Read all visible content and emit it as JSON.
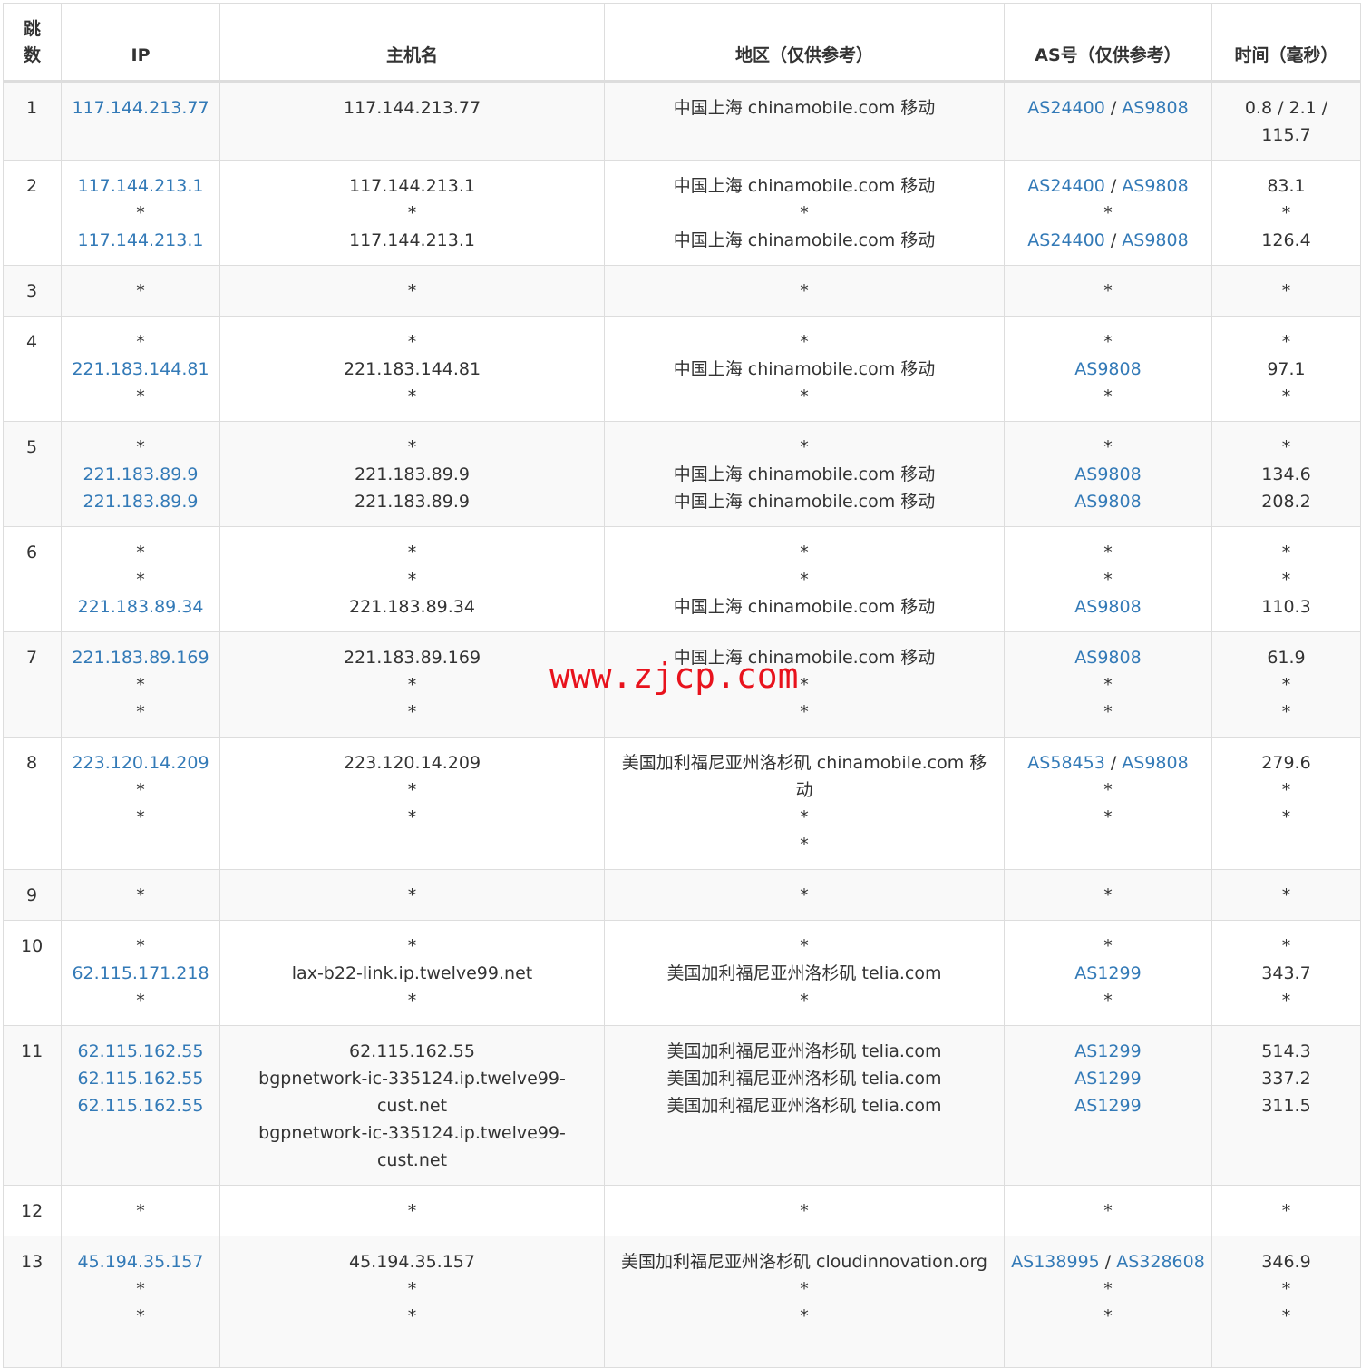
{
  "headers": {
    "hop": "跳数",
    "ip": "IP",
    "hostname": "主机名",
    "region": "地区（仅供参考）",
    "as": "AS号（仅供参考）",
    "time": "时间（毫秒）"
  },
  "watermark": "www.zjcp.com",
  "colors": {
    "link": "#337ab7",
    "watermark": "#e8131d",
    "stripe": "#f9f9f9",
    "border": "#dddddd"
  },
  "rows": [
    {
      "hop": "1",
      "ip": [
        [
          "117.144.213.77"
        ]
      ],
      "host": [
        "117.144.213.77"
      ],
      "region": [
        "中国上海 chinamobile.com 移动"
      ],
      "as": [
        [
          "AS24400",
          "AS9808"
        ]
      ],
      "time": [
        "0.8 / 2.1 / 115.7"
      ]
    },
    {
      "hop": "2",
      "ip": [
        [
          "117.144.213.1"
        ],
        [
          "*"
        ],
        [
          "117.144.213.1"
        ]
      ],
      "host": [
        "117.144.213.1",
        "*",
        "117.144.213.1"
      ],
      "region": [
        "中国上海 chinamobile.com 移动",
        "*",
        "中国上海 chinamobile.com 移动"
      ],
      "as": [
        [
          "AS24400",
          "AS9808"
        ],
        [
          "*"
        ],
        [
          "AS24400",
          "AS9808"
        ]
      ],
      "time": [
        "83.1",
        "*",
        "126.4"
      ]
    },
    {
      "hop": "3",
      "ip": [
        [
          "*"
        ]
      ],
      "host": [
        "*"
      ],
      "region": [
        "*"
      ],
      "as": [
        [
          "*"
        ]
      ],
      "time": [
        "*"
      ]
    },
    {
      "hop": "4",
      "ip": [
        [
          "*"
        ],
        [
          "221.183.144.81"
        ],
        [
          "*"
        ]
      ],
      "host": [
        "*",
        "221.183.144.81",
        "*"
      ],
      "region": [
        "*",
        "中国上海 chinamobile.com 移动",
        "*"
      ],
      "as": [
        [
          "*"
        ],
        [
          "AS9808"
        ],
        [
          "*"
        ]
      ],
      "time": [
        "*",
        "97.1",
        "*"
      ]
    },
    {
      "hop": "5",
      "ip": [
        [
          "*"
        ],
        [
          "221.183.89.9"
        ],
        [
          "221.183.89.9"
        ]
      ],
      "host": [
        "*",
        "221.183.89.9",
        "221.183.89.9"
      ],
      "region": [
        "*",
        "中国上海 chinamobile.com 移动",
        "中国上海 chinamobile.com 移动"
      ],
      "as": [
        [
          "*"
        ],
        [
          "AS9808"
        ],
        [
          "AS9808"
        ]
      ],
      "time": [
        "*",
        "134.6",
        "208.2"
      ]
    },
    {
      "hop": "6",
      "ip": [
        [
          "*"
        ],
        [
          "*"
        ],
        [
          "221.183.89.34"
        ]
      ],
      "host": [
        "*",
        "*",
        "221.183.89.34"
      ],
      "region": [
        "*",
        "*",
        "中国上海 chinamobile.com 移动"
      ],
      "as": [
        [
          "*"
        ],
        [
          "*"
        ],
        [
          "AS9808"
        ]
      ],
      "time": [
        "*",
        "*",
        "110.3"
      ]
    },
    {
      "hop": "7",
      "ip": [
        [
          "221.183.89.169"
        ],
        [
          "*"
        ],
        [
          "*"
        ]
      ],
      "host": [
        "221.183.89.169",
        "*",
        "*"
      ],
      "region": [
        "中国上海 chinamobile.com 移动",
        "*",
        "*"
      ],
      "as": [
        [
          "AS9808"
        ],
        [
          "*"
        ],
        [
          "*"
        ]
      ],
      "time": [
        "61.9",
        "*",
        "*"
      ]
    },
    {
      "hop": "8",
      "ip": [
        [
          "223.120.14.209"
        ],
        [
          "*"
        ],
        [
          "*"
        ]
      ],
      "host": [
        "223.120.14.209",
        "*",
        "*"
      ],
      "region": [
        "美国加利福尼亚州洛杉矶 chinamobile.com 移动",
        "*",
        "*"
      ],
      "as": [
        [
          "AS58453",
          "AS9808"
        ],
        [
          "*"
        ],
        [
          "*"
        ]
      ],
      "time": [
        "279.6",
        "*",
        "*"
      ]
    },
    {
      "hop": "9",
      "ip": [
        [
          "*"
        ]
      ],
      "host": [
        "*"
      ],
      "region": [
        "*"
      ],
      "as": [
        [
          "*"
        ]
      ],
      "time": [
        "*"
      ]
    },
    {
      "hop": "10",
      "ip": [
        [
          "*"
        ],
        [
          "62.115.171.218"
        ],
        [
          "*"
        ]
      ],
      "host": [
        "*",
        "lax-b22-link.ip.twelve99.net",
        "*"
      ],
      "region": [
        "*",
        "美国加利福尼亚州洛杉矶 telia.com",
        "*"
      ],
      "as": [
        [
          "*"
        ],
        [
          "AS1299"
        ],
        [
          "*"
        ]
      ],
      "time": [
        "*",
        "343.7",
        "*"
      ]
    },
    {
      "hop": "11",
      "ip": [
        [
          "62.115.162.55"
        ],
        [
          "62.115.162.55"
        ],
        [
          "62.115.162.55"
        ]
      ],
      "host": [
        "62.115.162.55",
        "bgpnetwork-ic-335124.ip.twelve99-cust.net",
        "bgpnetwork-ic-335124.ip.twelve99-cust.net"
      ],
      "region": [
        "美国加利福尼亚州洛杉矶 telia.com",
        "美国加利福尼亚州洛杉矶 telia.com",
        "美国加利福尼亚州洛杉矶 telia.com"
      ],
      "as": [
        [
          "AS1299"
        ],
        [
          "AS1299"
        ],
        [
          "AS1299"
        ]
      ],
      "time": [
        "514.3",
        "337.2",
        "311.5"
      ]
    },
    {
      "hop": "12",
      "ip": [
        [
          "*"
        ]
      ],
      "host": [
        "*"
      ],
      "region": [
        "*"
      ],
      "as": [
        [
          "*"
        ]
      ],
      "time": [
        "*"
      ]
    },
    {
      "hop": "13",
      "ip": [
        [
          "45.194.35.157"
        ],
        [
          "*"
        ],
        [
          "*"
        ]
      ],
      "host": [
        "45.194.35.157",
        "*",
        "*"
      ],
      "region": [
        "美国加利福尼亚州洛杉矶 cloudinnovation.org",
        "*",
        "*"
      ],
      "as": [
        [
          "AS138995",
          "AS328608"
        ],
        [
          "*"
        ],
        [
          "*"
        ]
      ],
      "time": [
        "346.9",
        "*",
        "*"
      ]
    }
  ]
}
